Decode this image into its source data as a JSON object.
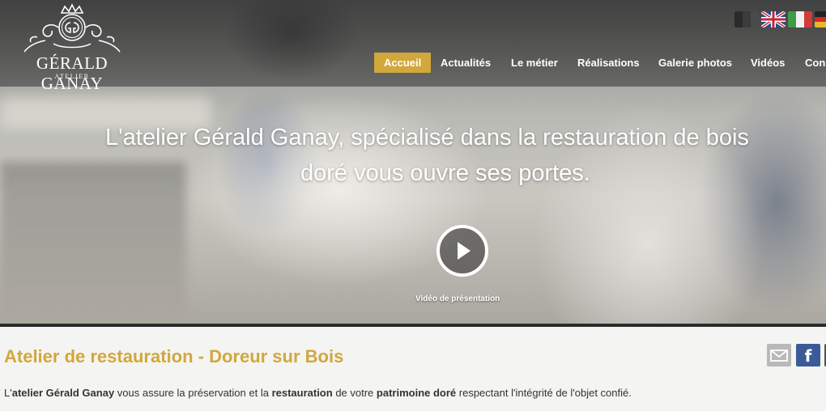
{
  "brand": {
    "name": "GÉRALD GANAY",
    "subtitle": "ATELIER",
    "logo_icon": "gg-monogram-crest-icon"
  },
  "languages": [
    {
      "name": "français",
      "colors": [
        "#2a2a2a",
        "#3b3b3b",
        "#4a4a4a"
      ]
    },
    {
      "name": "english",
      "colors": [
        "#2e4a8b",
        "#e8e8e8",
        "#c0283a"
      ]
    },
    {
      "name": "italiano",
      "colors": [
        "#3f9a4a",
        "#f2f2f2",
        "#d43a3a"
      ]
    },
    {
      "name": "deutsch",
      "colors": [
        "#222222",
        "#cf2a2a",
        "#e7b92a"
      ]
    }
  ],
  "nav": {
    "items": [
      {
        "label": "Accueil",
        "active": true
      },
      {
        "label": "Actualités",
        "active": false
      },
      {
        "label": "Le métier",
        "active": false
      },
      {
        "label": "Réalisations",
        "active": false
      },
      {
        "label": "Galerie photos",
        "active": false
      },
      {
        "label": "Vidéos",
        "active": false
      },
      {
        "label": "Con",
        "active": false
      }
    ],
    "active_color": "#d2a73c"
  },
  "hero": {
    "headline_line1": "L'atelier Gérald Ganay, spécialisé dans la restauration de bois",
    "headline_line2": "doré vous ouvre ses portes.",
    "play_icon": "play-circle-icon",
    "video_label": "Vidéo de présentation"
  },
  "content": {
    "title": "Atelier de restauration - Doreur sur Bois",
    "title_color": "#d2a73c",
    "intro": {
      "p1": "L'",
      "b1": "atelier Gérald Ganay",
      "p2": " vous assure la préservation et la ",
      "b2": "restauration",
      "p3": " de votre ",
      "b3": "patrimoine doré",
      "p4": " respectant l'intégrité de l'objet confié."
    }
  },
  "share": {
    "mail_icon": "envelope-icon",
    "facebook_icon": "facebook-icon",
    "facebook_glyph": "f"
  }
}
